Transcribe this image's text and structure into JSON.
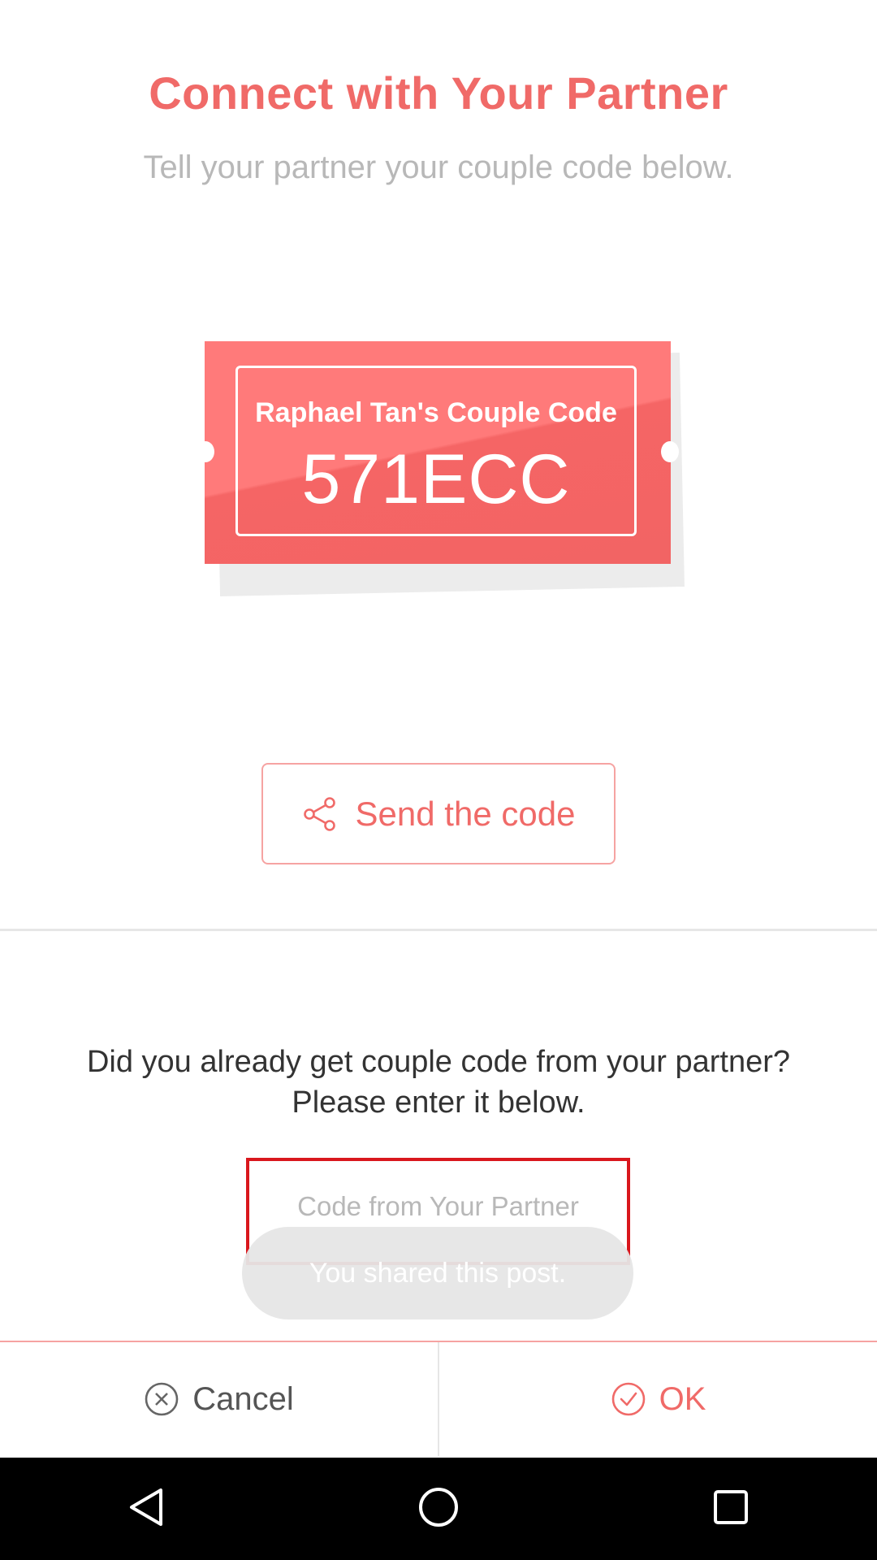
{
  "header": {
    "title": "Connect with Your Partner",
    "subtitle": "Tell your partner your couple code below."
  },
  "ticket": {
    "label": "Raphael Tan's Couple Code",
    "code": "571ECC"
  },
  "send_button": {
    "label": "Send the code",
    "icon": "share-icon"
  },
  "partner_section": {
    "question_line1": "Did you already get couple code from your partner?",
    "question_line2": "Please enter it below.",
    "input_placeholder": "Code from Your Partner",
    "input_value": ""
  },
  "toast": {
    "message": "You shared this post."
  },
  "bottom_bar": {
    "cancel_label": "Cancel",
    "cancel_icon": "close-circle-icon",
    "ok_label": "OK",
    "ok_icon": "check-circle-icon"
  },
  "system_nav": {
    "back_icon": "back-triangle-icon",
    "home_icon": "home-circle-icon",
    "recents_icon": "recents-square-icon"
  },
  "colors": {
    "accent": "#f06a68",
    "ticket": "#ff7a7a",
    "input_highlight": "#d9171d"
  }
}
